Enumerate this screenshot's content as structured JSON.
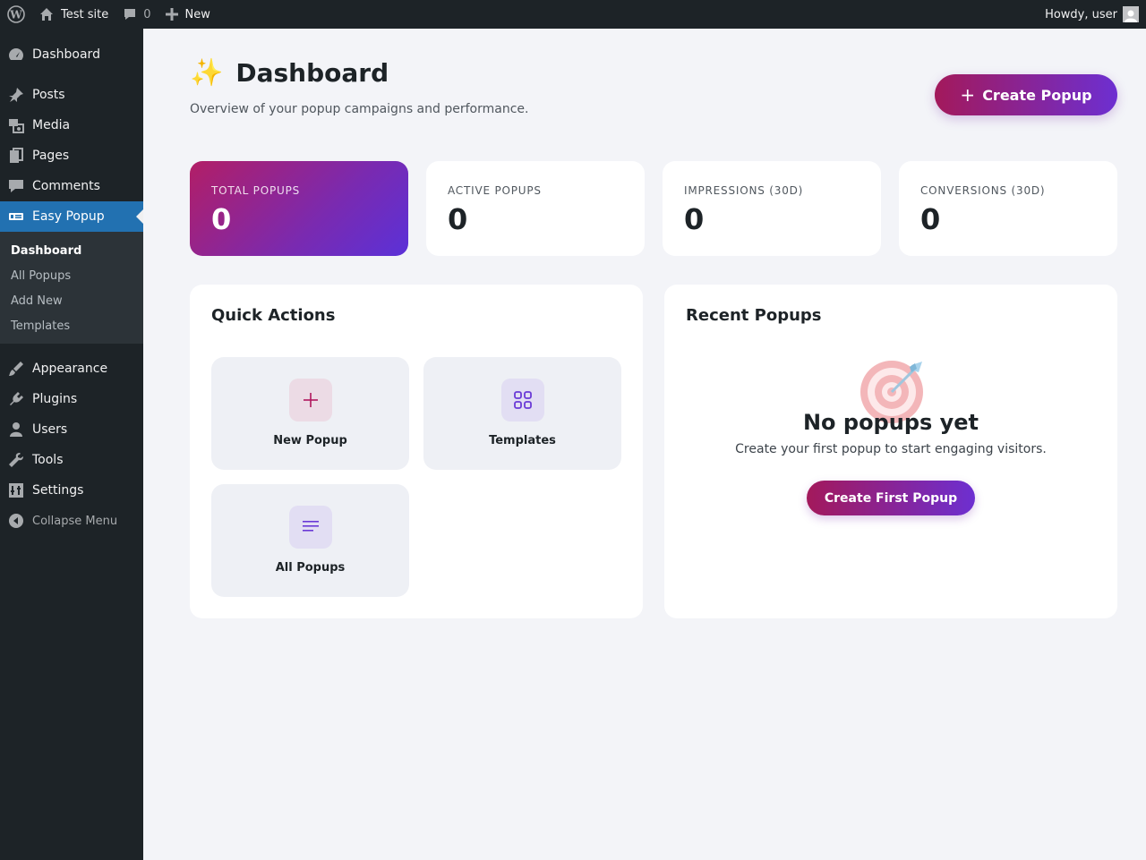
{
  "admin_bar": {
    "site_name": "Test site",
    "comments_count": "0",
    "new_label": "New",
    "greeting": "Howdy, user"
  },
  "sidebar": {
    "items": [
      {
        "label": "Dashboard",
        "icon": "dashboard-icon"
      },
      {
        "label": "Posts",
        "icon": "pin-icon"
      },
      {
        "label": "Media",
        "icon": "media-icon"
      },
      {
        "label": "Pages",
        "icon": "pages-icon"
      },
      {
        "label": "Comments",
        "icon": "comments-icon"
      },
      {
        "label": "Easy Popup",
        "icon": "popup-icon",
        "current": true
      },
      {
        "label": "Appearance",
        "icon": "brush-icon"
      },
      {
        "label": "Plugins",
        "icon": "plugin-icon"
      },
      {
        "label": "Users",
        "icon": "users-icon"
      },
      {
        "label": "Tools",
        "icon": "wrench-icon"
      },
      {
        "label": "Settings",
        "icon": "settings-icon"
      }
    ],
    "submenu": [
      "Dashboard",
      "All Popups",
      "Add New",
      "Templates"
    ],
    "collapse_label": "Collapse Menu"
  },
  "page": {
    "icon": "sparkles-icon",
    "title": "Dashboard",
    "subtitle": "Overview of your popup campaigns and performance.",
    "create_button": "Create Popup"
  },
  "stats": [
    {
      "label": "TOTAL POPUPS",
      "value": "0"
    },
    {
      "label": "ACTIVE POPUPS",
      "value": "0"
    },
    {
      "label": "IMPRESSIONS (30D)",
      "value": "0"
    },
    {
      "label": "CONVERSIONS (30D)",
      "value": "0"
    }
  ],
  "quick_actions": {
    "title": "Quick Actions",
    "items": [
      {
        "label": "New Popup",
        "icon": "plus-icon"
      },
      {
        "label": "Templates",
        "icon": "grid-icon"
      },
      {
        "label": "All Popups",
        "icon": "list-icon"
      }
    ]
  },
  "recent_popups": {
    "title": "Recent Popups",
    "empty_icon": "target-dart-icon",
    "empty_title": "No popups yet",
    "empty_text": "Create your first popup to start engaging visitors.",
    "button": "Create First Popup"
  },
  "colors": {
    "accent_start": "#a3195b",
    "accent_end": "#6d2fd1",
    "wp_dark": "#1d2327",
    "wp_blue": "#2271b1"
  }
}
